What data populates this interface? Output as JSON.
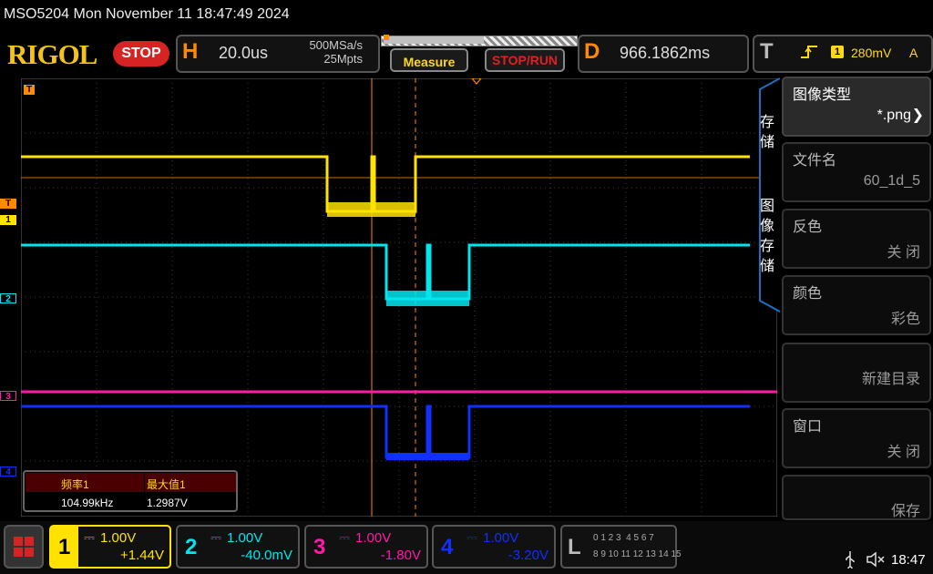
{
  "title": "MSO5204  Mon November 11 18:47:49 2024",
  "toolbar": {
    "logo": "RIGOL",
    "run_state": "STOP",
    "horizontal": {
      "letter": "H",
      "timebase": "20.0us",
      "sample_rate": "500MSa/s",
      "memory_depth": "25Mpts"
    },
    "measure_label": "Measure",
    "stop_run_label": "STOP/RUN",
    "delay": {
      "letter": "D",
      "value": "966.1862ms"
    },
    "trigger": {
      "letter": "T",
      "source": "1",
      "level": "280mV",
      "mode": "A"
    }
  },
  "markers": {
    "trigger": "T",
    "ch1": "1",
    "ch2": "2",
    "ch3": "3",
    "ch4": "4"
  },
  "side_menu": {
    "tab_save": [
      "存",
      "储"
    ],
    "tab_image_save": [
      "图",
      "像",
      "存",
      "储"
    ],
    "items": [
      {
        "title": "图像类型",
        "value": "*.png"
      },
      {
        "title": "文件名",
        "value": "60_1d_5"
      },
      {
        "title": "反色",
        "value": "关 闭"
      },
      {
        "title": "颜色",
        "value": "彩色"
      },
      {
        "title": "",
        "value": "新建目录"
      },
      {
        "title": "窗口",
        "value": "关 闭"
      },
      {
        "title": "",
        "value": "保存"
      }
    ]
  },
  "measurements": {
    "freq_label": "频率1",
    "freq_value": "104.99kHz",
    "max_label": "最大值1",
    "max_value": "1.2987V"
  },
  "channels": [
    {
      "num": "1",
      "scale": "1.00V",
      "offset": "+1.44V",
      "color": "#ffe200"
    },
    {
      "num": "2",
      "scale": "1.00V",
      "offset": "-40.0mV",
      "color": "#00e5ee"
    },
    {
      "num": "3",
      "scale": "1.00V",
      "offset": "-1.80V",
      "color": "#ff1aa8"
    },
    {
      "num": "4",
      "scale": "1.00V",
      "offset": "-3.20V",
      "color": "#1030ff"
    }
  ],
  "logic": {
    "letter": "L",
    "row1": "0 1 2 3  4 5 6 7",
    "row2": "8 9 10 11 12 13 14 15"
  },
  "status": {
    "time": "18:47"
  },
  "colors": {
    "accent": "#ff8a00",
    "ch1": "#ffe200",
    "ch2": "#00e5ee",
    "ch3": "#ff1aa8",
    "ch4": "#1030ff"
  }
}
